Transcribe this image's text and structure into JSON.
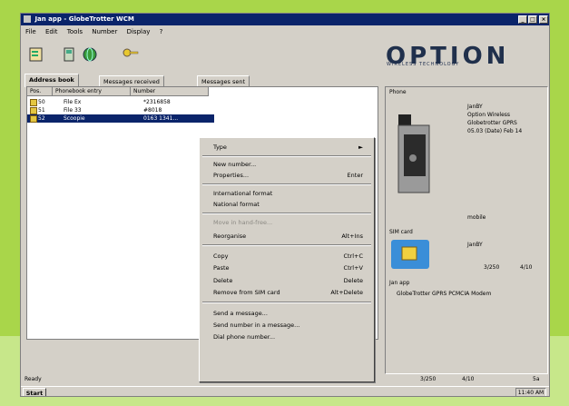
{
  "window": {
    "title": "Jan app - GlobeTrotter WCM",
    "ctrl_min": "_",
    "ctrl_max": "□",
    "ctrl_close": "×"
  },
  "menubar": [
    "File",
    "Edit",
    "Tools",
    "Number",
    "Display",
    "?"
  ],
  "logo": {
    "text": "OPTION",
    "subtitle": "WIRELESS TECHNOLOGY"
  },
  "tabs": [
    "Address book",
    "Messages received",
    "Messages sent"
  ],
  "list": {
    "columns": [
      "Pos.",
      "Phonebook entry",
      "Number"
    ],
    "rows": [
      {
        "pos": "50",
        "entry": "File Ex",
        "number": "*2316858"
      },
      {
        "pos": "51",
        "entry": "File 33",
        "number": "#8018"
      },
      {
        "pos": "52",
        "entry": "Scoopie",
        "number": "0163 1341..."
      }
    ]
  },
  "context_menu": [
    {
      "label": "Type",
      "shortcut": "►",
      "disabled": false
    },
    {
      "label": "New number...",
      "shortcut": "",
      "disabled": false
    },
    {
      "label": "Properties...",
      "shortcut": "Enter",
      "disabled": false
    },
    {
      "label": "International format",
      "shortcut": "",
      "disabled": false
    },
    {
      "label": "National format",
      "shortcut": "",
      "disabled": false
    },
    {
      "label": "Move in hand-free...",
      "shortcut": "",
      "disabled": true
    },
    {
      "label": "Reorganise",
      "shortcut": "Alt+Ins",
      "disabled": false
    },
    {
      "label": "Copy",
      "shortcut": "Ctrl+C",
      "disabled": false
    },
    {
      "label": "Paste",
      "shortcut": "Ctrl+V",
      "disabled": false
    },
    {
      "label": "Delete",
      "shortcut": "Delete",
      "disabled": false
    },
    {
      "label": "Remove from SIM card",
      "shortcut": "Alt+Delete",
      "disabled": false
    },
    {
      "label": "Send a message...",
      "shortcut": "",
      "disabled": false
    },
    {
      "label": "Send number in a message...",
      "shortcut": "",
      "disabled": false
    },
    {
      "label": "Dial phone number...",
      "shortcut": "",
      "disabled": false
    }
  ],
  "right_panel": {
    "phone_title": "Phone",
    "phone_lines": [
      "JanBY",
      "Option Wireless",
      "Globetrotter GPRS",
      "05.03 (Date) Feb 14"
    ],
    "phone_status": "mobile",
    "sim_title": "SIM card",
    "sim_name": "JanBY",
    "sim_counts": [
      "3/250",
      "4/10"
    ],
    "app_title": "Jan app",
    "app_line": "GlobeTrotter GPRS PCMCIA Modem"
  },
  "status": {
    "text": "Ready",
    "count1": "3/250",
    "count2": "4/10",
    "extra": "5a"
  },
  "taskbar": {
    "start": "Start",
    "clock": "11:40 AM"
  }
}
